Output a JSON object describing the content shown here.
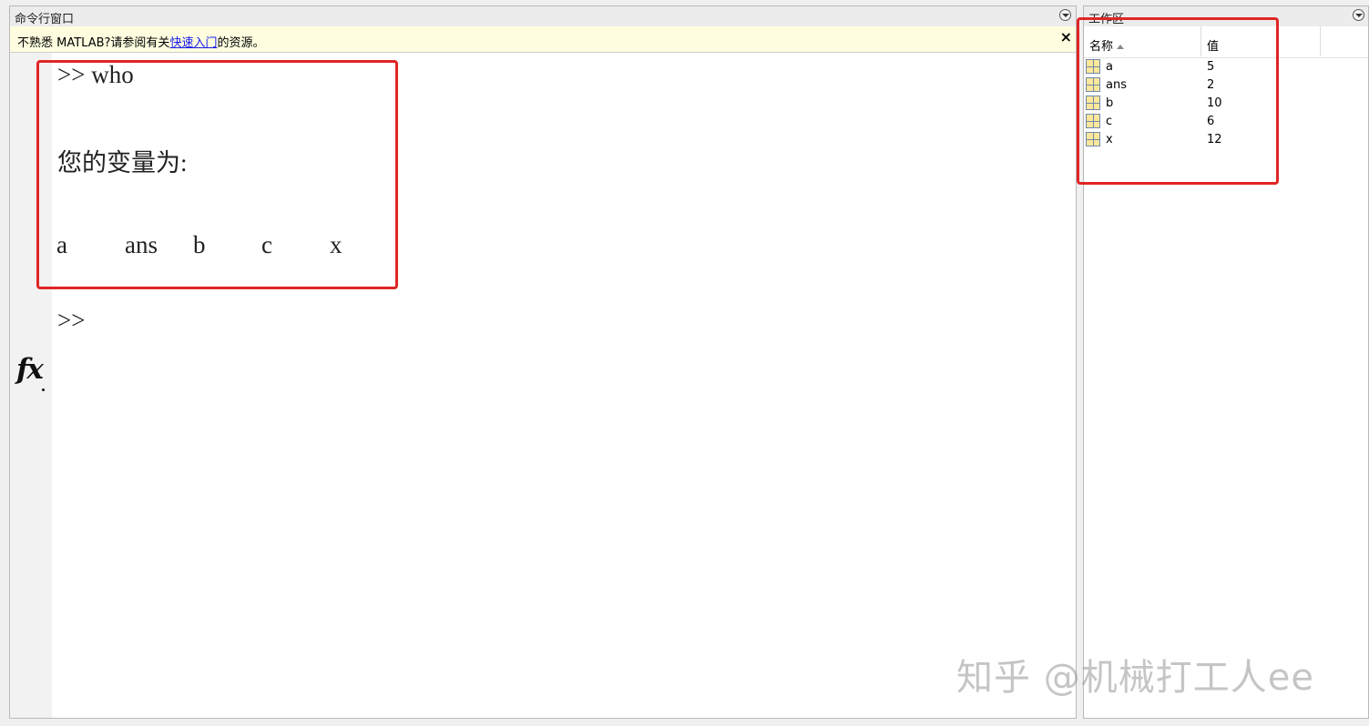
{
  "command_window": {
    "title": "命令行窗口",
    "notice": {
      "prefix": "不熟悉 MATLAB?请参阅有关",
      "link": "快速入门",
      "suffix": "的资源。",
      "close": "×"
    },
    "lines": {
      "command": ">> who",
      "heading": "您的变量为:",
      "prompt": ">>"
    },
    "variables": [
      "a",
      "ans",
      "b",
      "c",
      "x"
    ],
    "fx_icon": "fx"
  },
  "workspace": {
    "title": "工作区",
    "columns": {
      "name": "名称",
      "value": "值"
    },
    "rows": [
      {
        "name": "a",
        "value": "5"
      },
      {
        "name": "ans",
        "value": "2"
      },
      {
        "name": "b",
        "value": "10"
      },
      {
        "name": "c",
        "value": "6"
      },
      {
        "name": "x",
        "value": "12"
      }
    ]
  },
  "colors": {
    "highlight": "#e02525",
    "notice_bg": "#fefde0",
    "link": "#1a1aee"
  },
  "watermark": "知乎 @机械打工人ee"
}
